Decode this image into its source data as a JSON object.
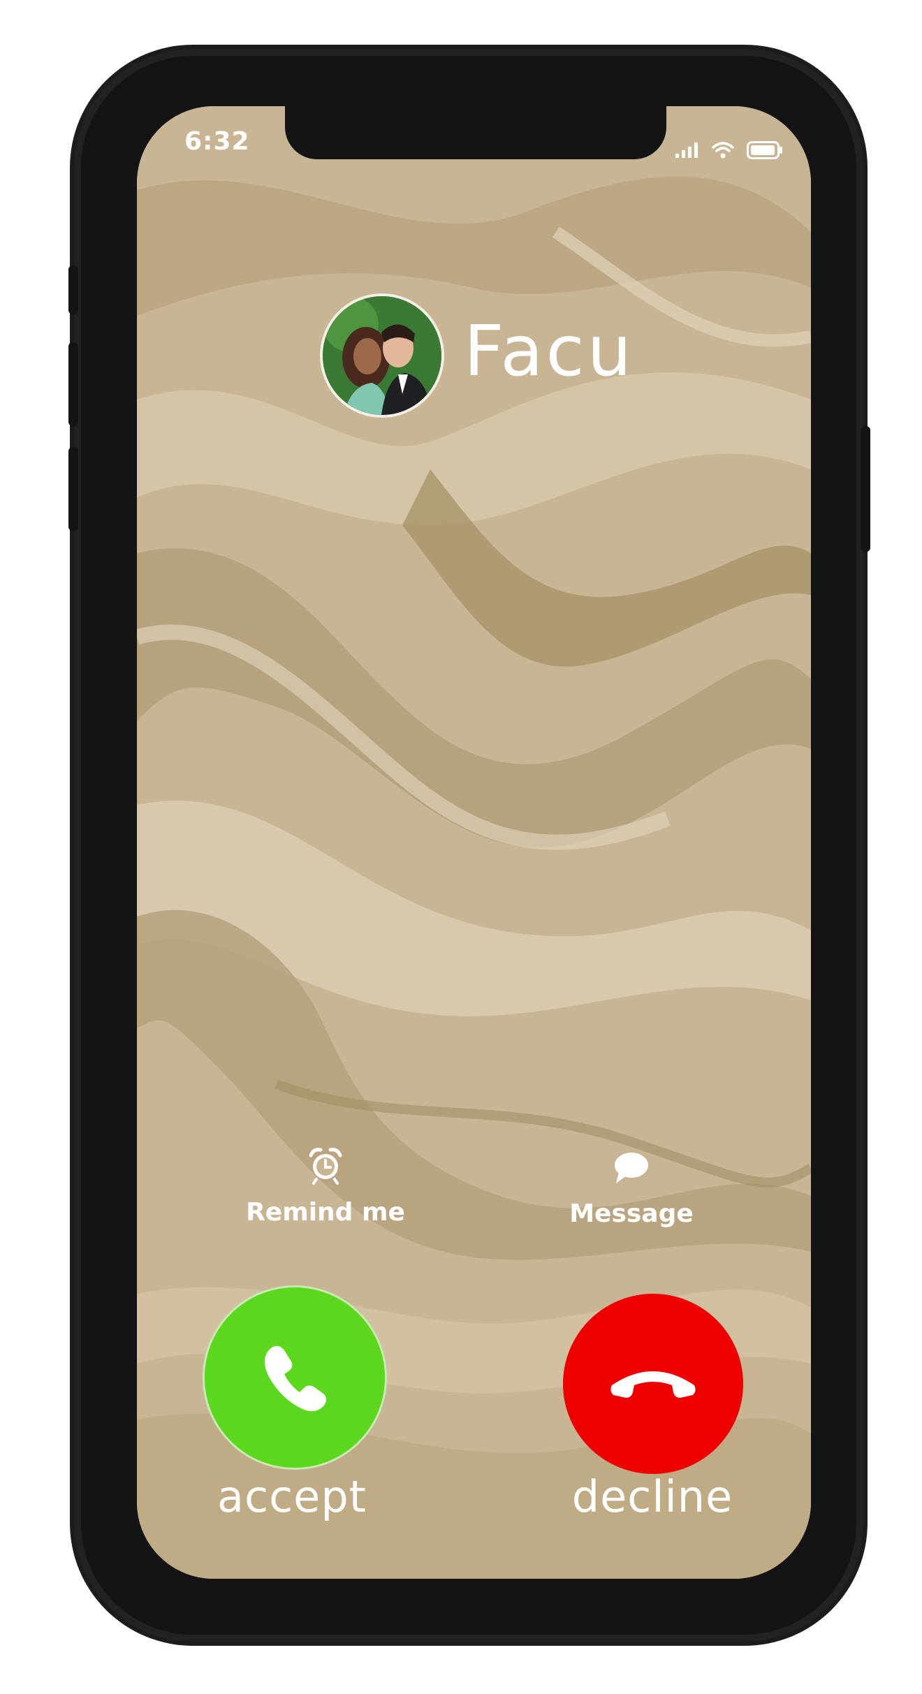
{
  "status_bar": {
    "time": "6:32",
    "signal_icon": "cellular-signal-icon",
    "wifi_icon": "wifi-icon",
    "battery_icon": "battery-icon"
  },
  "caller": {
    "name": "Facu",
    "avatar_icon": "caller-avatar"
  },
  "actions": {
    "remind": {
      "label": "Remind me",
      "icon": "alarm-clock-icon"
    },
    "message": {
      "label": "Message",
      "icon": "speech-bubble-icon"
    }
  },
  "call_buttons": {
    "accept": {
      "label": "accept",
      "icon": "phone-handset-icon",
      "color": "#5bd81e"
    },
    "decline": {
      "label": "decline",
      "icon": "hang-up-icon",
      "color": "#ee0000"
    }
  },
  "colors": {
    "phone_frame": "#141414",
    "wallpaper_base": "#c8b594",
    "text": "#ffffff"
  }
}
